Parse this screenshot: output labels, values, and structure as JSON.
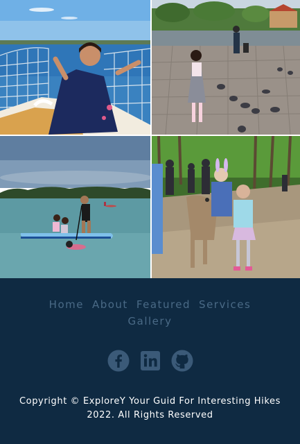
{
  "gallery": {
    "photos": [
      {
        "subject": "girl-on-sailboat-photo"
      },
      {
        "subject": "girl-with-pigeons-photo"
      },
      {
        "subject": "paddleboard-lake-photo"
      },
      {
        "subject": "girls-with-deer-photo"
      }
    ]
  },
  "footer": {
    "nav": {
      "home": "Home",
      "about": "About",
      "featured": "Featured",
      "services": "Services",
      "gallery": "Gallery"
    },
    "socials": [
      {
        "icon": "facebook-icon"
      },
      {
        "icon": "linkedin-icon"
      },
      {
        "icon": "github-icon"
      }
    ],
    "copyright": "Copyright © ExploreY Your Guid For Interesting Hikes 2022. All Rights Reserved"
  },
  "colors": {
    "footer_bg": "#0f2a42",
    "nav_link": "#4a6a86",
    "icon": "#3b5a78",
    "copyright_text": "#ffffff"
  }
}
